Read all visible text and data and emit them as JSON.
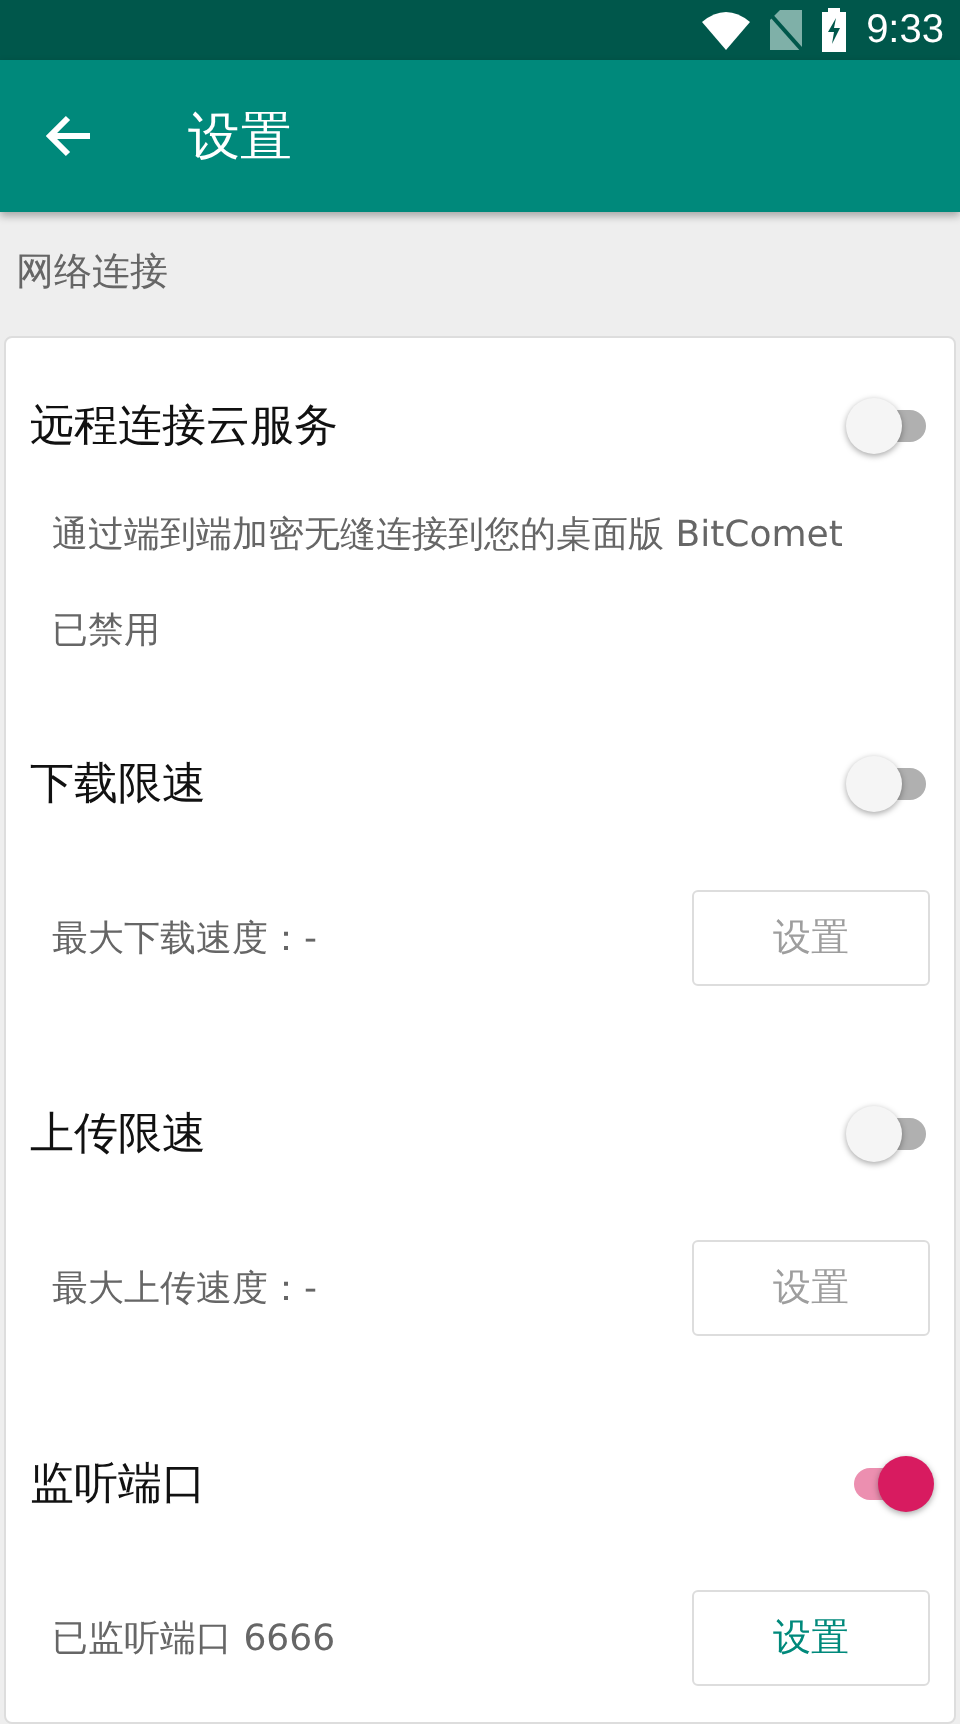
{
  "status_bar": {
    "time": "9:33"
  },
  "app_bar": {
    "title": "设置"
  },
  "section": {
    "title": "网络连接"
  },
  "settings": [
    {
      "title": "远程连接云服务",
      "on": false,
      "details": [
        {
          "kind": "text",
          "text": "通过端到端加密无缝连接到您的桌面版 BitComet"
        },
        {
          "kind": "text",
          "text": "已禁用"
        }
      ]
    },
    {
      "title": "下载限速",
      "on": false,
      "details": [
        {
          "kind": "action",
          "text": "最大下载速度：-",
          "button": "设置",
          "disabled": true
        }
      ]
    },
    {
      "title": "上传限速",
      "on": false,
      "details": [
        {
          "kind": "action",
          "text": "最大上传速度：-",
          "button": "设置",
          "disabled": true
        }
      ]
    },
    {
      "title": "监听端口",
      "on": true,
      "details": [
        {
          "kind": "action",
          "text": "已监听端口 6666",
          "button": "设置",
          "disabled": false
        }
      ]
    }
  ]
}
